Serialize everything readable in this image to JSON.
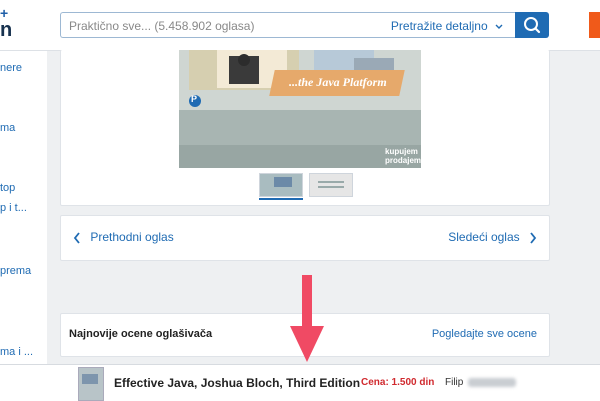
{
  "header": {
    "logo_top": "+",
    "logo_bottom": "n",
    "search_placeholder": "Praktično sve... (5.458.902 oglasa)",
    "detail_search_label": "Pretražite detaljno",
    "search_icon": "search-icon"
  },
  "sidebar": {
    "items": [
      {
        "label": "nere"
      },
      {
        "label": "ma"
      },
      {
        "label": "top"
      },
      {
        "label": "p i t..."
      },
      {
        "label": "prema"
      },
      {
        "label": "ma i ..."
      }
    ]
  },
  "gallery": {
    "photo_caption": "...the Java Platform",
    "photo_publisher_mark": "P",
    "photo_watermark_line1": "kupujem",
    "photo_watermark_line2": "prodajem",
    "thumbnail_count": 2,
    "active_thumbnail": 1
  },
  "navigation": {
    "prev_label": "Prethodni oglas",
    "next_label": "Sledeći oglas"
  },
  "ratings": {
    "title": "Najnovije ocene oglašivača",
    "link_label": "Pogledajte sve ocene"
  },
  "bottom_bar": {
    "title": "Effective Java, Joshua Bloch, Third Edition",
    "price": "Cena: 1.500 din",
    "seller_name": "Filip"
  },
  "colors": {
    "accent": "#1f6bb3",
    "price": "#d0292e",
    "annotation_arrow": "#f04a64",
    "orange_tab": "#f05a1a"
  }
}
